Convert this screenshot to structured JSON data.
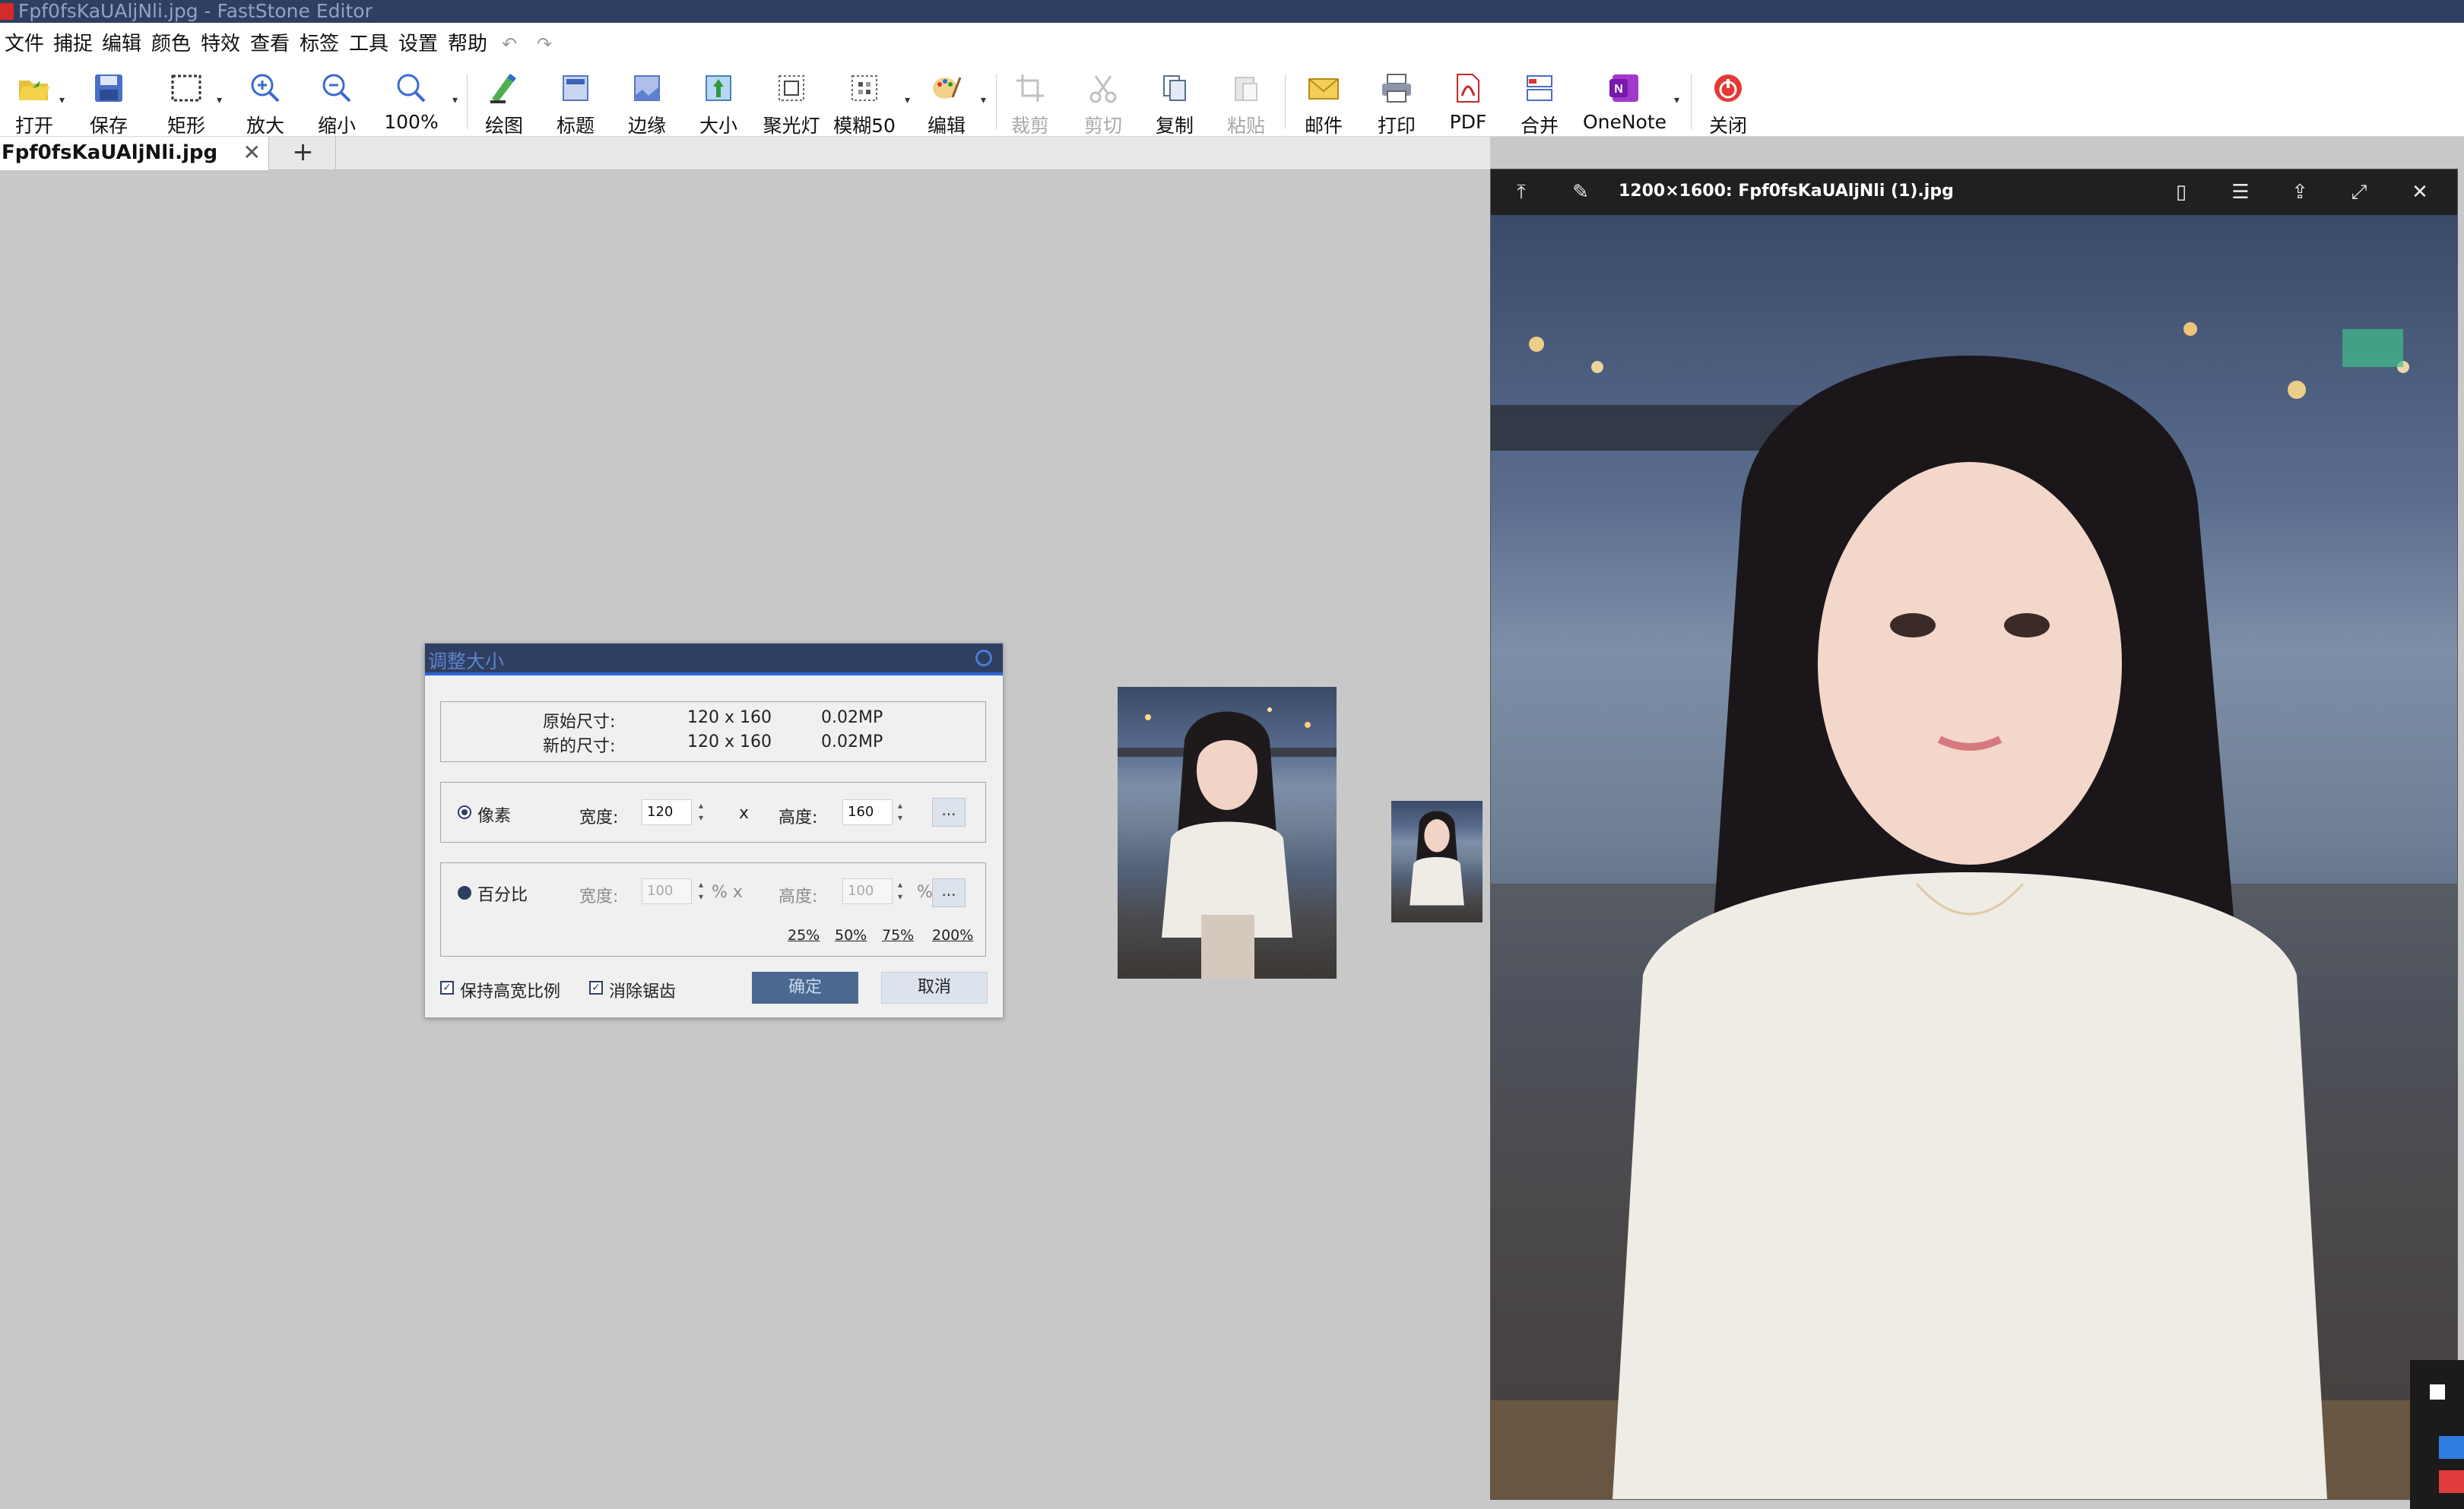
{
  "window": {
    "title": "Fpf0fsKaUAljNli.jpg - FastStone Editor"
  },
  "menu": {
    "items": [
      "文件",
      "捕捉",
      "编辑",
      "颜色",
      "特效",
      "查看",
      "标签",
      "工具",
      "设置",
      "帮助"
    ],
    "undo": "↶",
    "redo": "↷"
  },
  "toolbar": {
    "open": "打开",
    "save": "保存",
    "rect": "矩形",
    "zoom_in": "放大",
    "zoom_out": "缩小",
    "zoom_100": "100%",
    "draw": "绘图",
    "caption": "标题",
    "edge": "边缘",
    "resize": "大小",
    "spotlight": "聚光灯",
    "blur": "模糊50",
    "edit": "编辑",
    "crop": "裁剪",
    "cut": "剪切",
    "copy": "复制",
    "paste": "粘贴",
    "mail": "邮件",
    "print": "打印",
    "pdf": "PDF",
    "merge": "合并",
    "onenote": "OneNote",
    "close": "关闭"
  },
  "tabs": {
    "active": "Fpf0fsKaUAljNli.jpg",
    "close": "✕",
    "add": "+"
  },
  "dialog": {
    "title": "调整大小",
    "original_label": "原始尺寸:",
    "original_size": "120 x 160",
    "original_mp": "0.02MP",
    "new_label": "新的尺寸:",
    "new_size": "120 x 160",
    "new_mp": "0.02MP",
    "pixel_label": "像素",
    "width_label": "宽度:",
    "height_label": "高度:",
    "pixel_width": "120",
    "pixel_height": "160",
    "x_sep": "x",
    "more": "...",
    "percent_label": "百分比",
    "pct_width": "100",
    "pct_height": "100",
    "pct_sign": "%",
    "pct_x": "% x",
    "presets": [
      "25%",
      "50%",
      "75%",
      "200%"
    ],
    "keep_ratio": "保持高宽比例",
    "antialias": "消除锯齿",
    "ok": "确定",
    "cancel": "取消"
  },
  "viewer": {
    "title": "1200×1600: Fpf0fsKaUAljNli (1).jpg"
  }
}
